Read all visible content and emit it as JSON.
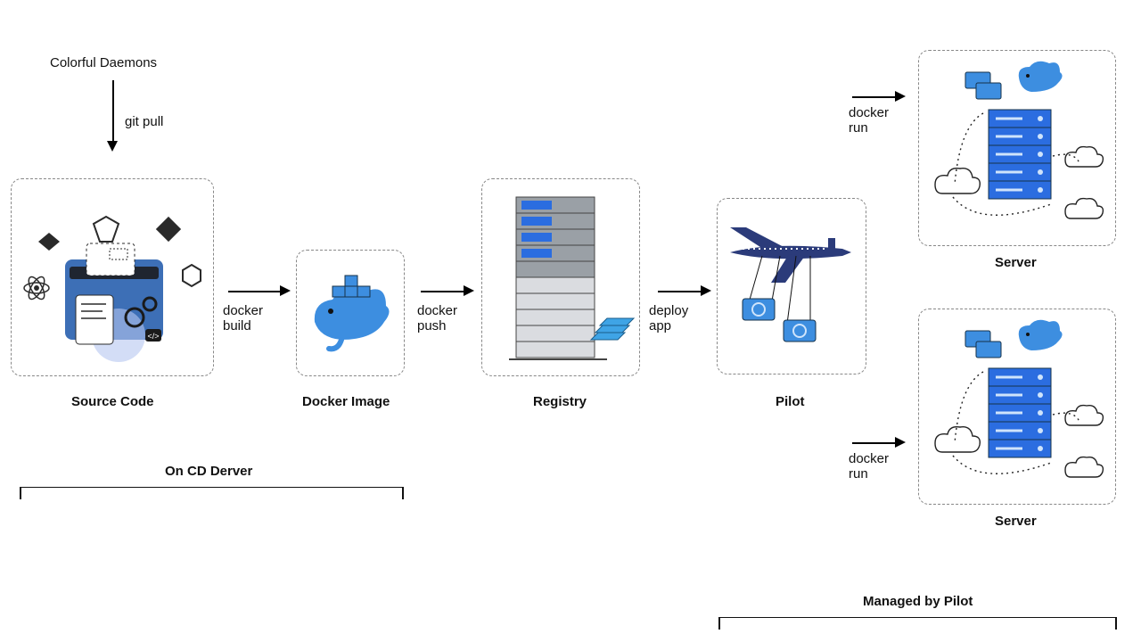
{
  "title": "Colorful Daemons",
  "arrows": {
    "git_pull": "git pull",
    "docker_build": "docker build",
    "docker_push": "docker push",
    "deploy_app": "deploy app",
    "docker_run_1": "docker run",
    "docker_run_2": "docker run"
  },
  "nodes": {
    "source_code": "Source Code",
    "docker_image": "Docker Image",
    "registry": "Registry",
    "pilot": "Pilot",
    "server_1": "Server",
    "server_2": "Server"
  },
  "groups": {
    "cd_server": "On CD Derver",
    "managed_by_pilot": "Managed by Pilot"
  }
}
